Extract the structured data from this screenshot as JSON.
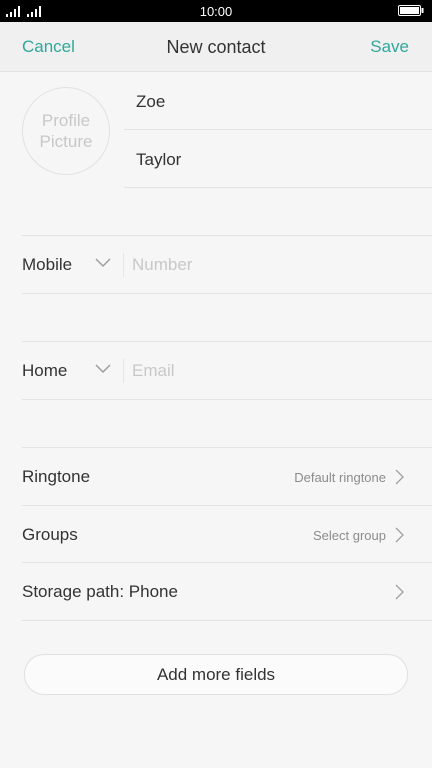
{
  "status_bar": {
    "time": "10:00"
  },
  "header": {
    "cancel_label": "Cancel",
    "title": "New contact",
    "save_label": "Save"
  },
  "profile": {
    "picture_line1": "Profile",
    "picture_line2": "Picture",
    "first_name": "Zoe",
    "last_name": "Taylor"
  },
  "phone": {
    "type_label": "Mobile",
    "placeholder": "Number",
    "value": ""
  },
  "email": {
    "type_label": "Home",
    "placeholder": "Email",
    "value": ""
  },
  "settings": {
    "ringtone_label": "Ringtone",
    "ringtone_value": "Default ringtone",
    "groups_label": "Groups",
    "groups_value": "Select group",
    "storage_label": "Storage path: Phone"
  },
  "add_more_label": "Add more fields",
  "colors": {
    "accent": "#2fa89b",
    "background": "#f6f6f6",
    "status_bar": "#000000"
  },
  "icons": {
    "signal": "signal-bars-icon",
    "battery": "battery-icon",
    "dropdown": "chevron-down-icon",
    "disclosure": "chevron-right-icon"
  }
}
